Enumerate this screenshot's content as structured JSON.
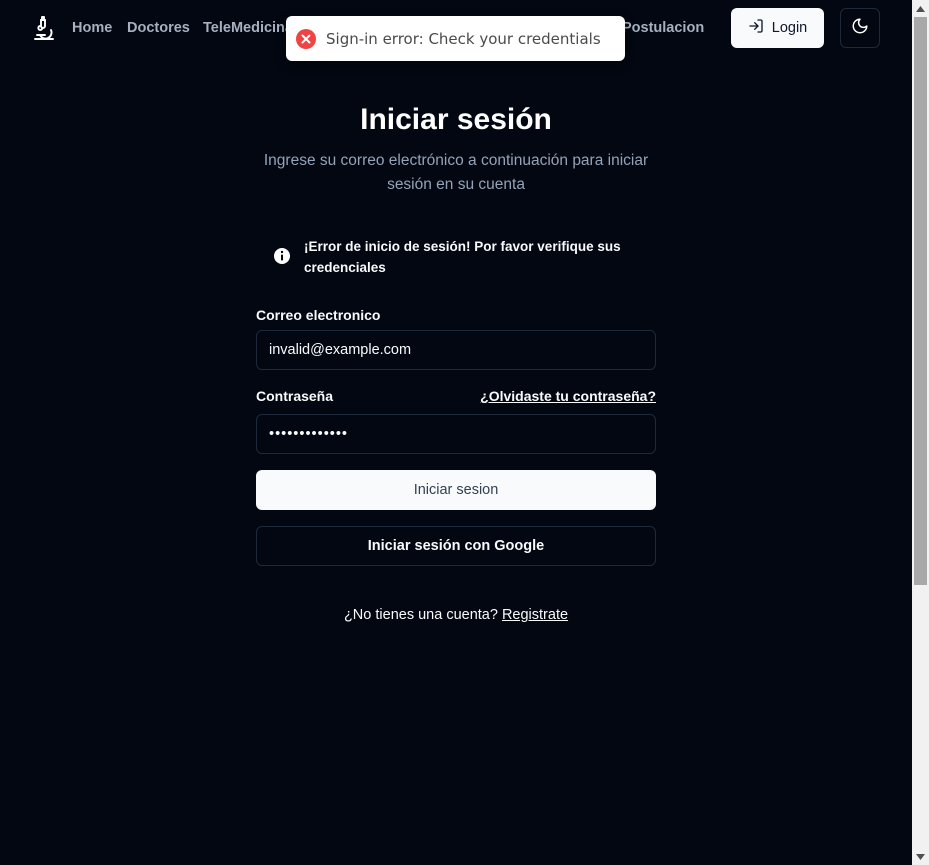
{
  "nav": {
    "links": [
      "Home",
      "Doctores",
      "TeleMedicina",
      "Postulacion"
    ],
    "login_label": "Login",
    "theme_icon": "moon-icon",
    "logo_icon": "microscope-icon"
  },
  "toast": {
    "message": "Sign-in error: Check your credentials",
    "icon": "error-circle-icon",
    "color": "#ef4444"
  },
  "page": {
    "title": "Iniciar sesión",
    "subtitle": "Ingrese su correo electrónico a continuación para iniciar sesión en su cuenta"
  },
  "alert": {
    "message": "¡Error de inicio de sesión! Por favor verifique sus credenciales",
    "icon": "info-icon"
  },
  "form": {
    "email_label": "Correo electronico",
    "email_value": "invalid@example.com",
    "password_label": "Contraseña",
    "password_value": "•••••••••••••",
    "forgot_link": "¿Olvidaste tu contraseña?",
    "submit_label": "Iniciar sesion",
    "google_label": "Iniciar sesión con Google"
  },
  "signup": {
    "prompt": "¿No tienes una cuenta?",
    "link": "Registrate"
  },
  "colors": {
    "background": "#030711",
    "border": "#1e293b",
    "muted_text": "#94a3b8"
  }
}
